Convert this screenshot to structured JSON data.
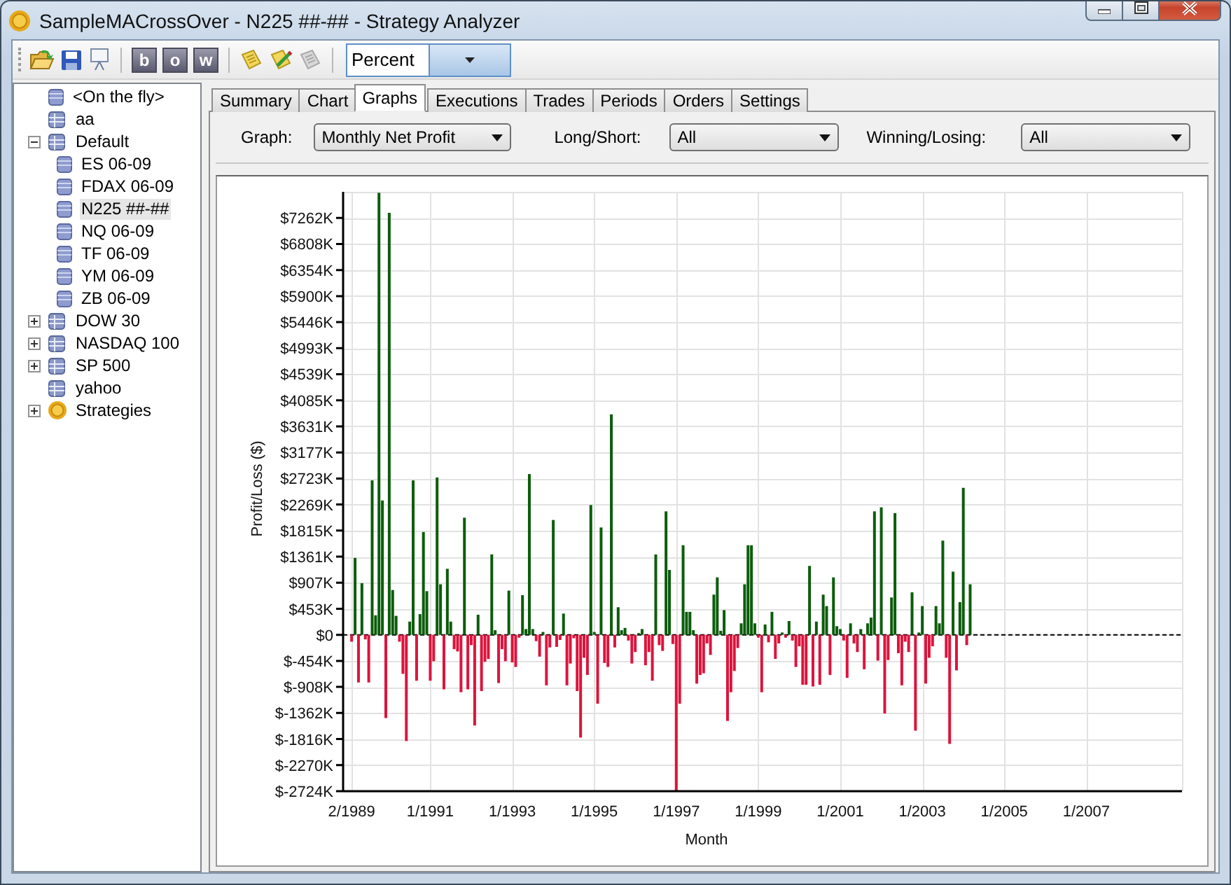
{
  "window": {
    "title": "SampleMACrossOver - N225 ##-## - Strategy Analyzer"
  },
  "toolbar": {
    "letter_buttons": [
      "b",
      "o",
      "w"
    ],
    "dropdown": {
      "value": "Percent"
    }
  },
  "tree": {
    "items": [
      {
        "label": "<On the fly>",
        "kind": "instrument",
        "selected": false
      },
      {
        "label": "aa",
        "kind": "list",
        "selected": false
      },
      {
        "label": "Default",
        "kind": "list",
        "expanded": true,
        "selected": false,
        "children": [
          {
            "label": "ES 06-09",
            "kind": "instrument",
            "selected": false
          },
          {
            "label": "FDAX 06-09",
            "kind": "instrument",
            "selected": false
          },
          {
            "label": "N225 ##-##",
            "kind": "instrument",
            "selected": true
          },
          {
            "label": "NQ 06-09",
            "kind": "instrument",
            "selected": false
          },
          {
            "label": "TF 06-09",
            "kind": "instrument",
            "selected": false
          },
          {
            "label": "YM 06-09",
            "kind": "instrument",
            "selected": false
          },
          {
            "label": "ZB 06-09",
            "kind": "instrument",
            "selected": false
          }
        ]
      },
      {
        "label": "DOW 30",
        "kind": "list",
        "expanded": false,
        "selected": false
      },
      {
        "label": "NASDAQ 100",
        "kind": "list",
        "expanded": false,
        "selected": false
      },
      {
        "label": "SP 500",
        "kind": "list",
        "expanded": false,
        "selected": false
      },
      {
        "label": "yahoo",
        "kind": "list",
        "selected": false
      },
      {
        "label": "Strategies",
        "kind": "strategy",
        "expanded": false,
        "selected": false
      }
    ]
  },
  "tabs": [
    {
      "label": "Summary",
      "selected": false
    },
    {
      "label": "Chart",
      "selected": false
    },
    {
      "label": "Graphs",
      "selected": true
    },
    {
      "label": "Executions",
      "selected": false
    },
    {
      "label": "Trades",
      "selected": false
    },
    {
      "label": "Periods",
      "selected": false
    },
    {
      "label": "Orders",
      "selected": false
    },
    {
      "label": "Settings",
      "selected": false
    }
  ],
  "filters": [
    {
      "label": "Graph:",
      "value": "Monthly Net Profit"
    },
    {
      "label": "Long/Short:",
      "value": "All"
    },
    {
      "label": "Winning/Losing:",
      "value": "All"
    }
  ],
  "graph": {
    "chart_data": {
      "type": "bar",
      "xlabel": "Month",
      "ylabel": "Profit/Loss ($)",
      "grid": true,
      "categories": [
        "2/1989",
        null,
        null,
        null,
        null,
        null,
        null,
        null,
        null,
        null,
        null,
        null,
        null,
        null,
        null,
        null,
        null,
        null,
        null,
        null,
        null,
        null,
        null,
        "1/1991",
        null,
        null,
        null,
        null,
        null,
        null,
        null,
        null,
        null,
        null,
        null,
        null,
        null,
        null,
        null,
        null,
        null,
        null,
        null,
        null,
        null,
        null,
        null,
        "1/1993",
        null,
        null,
        null,
        null,
        null,
        null,
        null,
        null,
        null,
        null,
        null,
        null,
        null,
        null,
        null,
        null,
        null,
        null,
        null,
        null,
        null,
        null,
        null,
        "1/1995",
        null,
        null,
        null,
        null,
        null,
        null,
        null,
        null,
        null,
        null,
        null,
        null,
        null,
        null,
        null,
        null,
        null,
        null,
        null,
        null,
        null,
        null,
        null,
        "1/1997",
        null,
        null,
        null,
        null,
        null,
        null,
        null,
        null,
        null,
        null,
        null,
        null,
        null,
        null,
        null,
        null,
        null,
        null,
        null,
        null,
        null,
        null,
        null,
        "1/1999",
        null,
        null,
        null,
        null,
        null,
        null,
        null,
        null,
        null,
        null,
        null,
        null,
        null,
        null,
        null,
        null,
        null,
        null,
        null,
        null,
        null,
        null,
        null,
        "1/2001",
        null,
        null,
        null,
        null,
        null,
        null,
        null,
        null,
        null,
        null,
        null,
        null,
        null,
        null,
        null,
        null,
        null,
        null,
        null,
        null,
        null,
        null,
        null,
        "1/2003",
        null,
        null,
        null,
        null,
        null,
        null,
        null,
        null,
        null,
        null,
        null,
        null,
        null,
        null,
        null,
        null,
        null,
        null,
        null,
        null,
        null,
        null,
        null,
        "1/2005",
        null,
        null,
        null,
        null,
        null,
        null,
        null,
        null,
        null,
        null,
        null,
        null,
        null,
        null,
        null,
        null,
        null,
        null,
        null,
        null,
        null,
        null,
        null,
        "1/2007",
        null,
        null,
        null,
        null,
        null,
        null,
        null,
        null,
        null,
        null,
        null,
        null,
        null,
        null,
        null,
        null,
        null,
        null,
        null,
        null,
        null,
        null,
        null,
        null,
        null,
        null,
        null,
        null
      ],
      "series": [
        {
          "color": "#0b5d0b",
          "values": [
            null,
            1340,
            null,
            900,
            null,
            null,
            2690,
            340,
            7700,
            2340,
            null,
            7350,
            780,
            330,
            null,
            null,
            null,
            230,
            2690,
            null,
            360,
            1790,
            760,
            null,
            null,
            2740,
            880,
            null,
            1150,
            230,
            null,
            null,
            null,
            2040,
            null,
            null,
            null,
            350,
            null,
            null,
            null,
            1400,
            80,
            null,
            null,
            null,
            770,
            null,
            null,
            null,
            690,
            100,
            2800,
            100,
            null,
            null,
            50,
            null,
            null,
            2000,
            null,
            null,
            370,
            null,
            null,
            null,
            null,
            null,
            null,
            null,
            2260,
            50,
            null,
            1870,
            null,
            null,
            3840,
            null,
            480,
            80,
            120,
            null,
            null,
            null,
            30,
            100,
            null,
            null,
            null,
            1400,
            null,
            null,
            2150,
            1130,
            null,
            null,
            null,
            1560,
            400,
            400,
            80,
            null,
            null,
            null,
            null,
            null,
            700,
            1000,
            70,
            430,
            null,
            null,
            null,
            null,
            200,
            880,
            1560,
            1560,
            200,
            null,
            null,
            180,
            null,
            400,
            null,
            null,
            40,
            null,
            240,
            null,
            null,
            null,
            null,
            null,
            1200,
            null,
            230,
            null,
            700,
            500,
            null,
            1000,
            150,
            100,
            null,
            null,
            200,
            null,
            null,
            100,
            null,
            200,
            300,
            2150,
            null,
            2220,
            null,
            null,
            650,
            2120,
            null,
            null,
            null,
            null,
            740,
            null,
            40,
            500,
            null,
            null,
            null,
            500,
            200,
            1640,
            null,
            null,
            1100,
            null,
            570,
            2560,
            null,
            880,
            null,
            null,
            null,
            null,
            null,
            null,
            null,
            null,
            null,
            null,
            null,
            null,
            null,
            null,
            null,
            null,
            null,
            null,
            null,
            null,
            null,
            null,
            null,
            null,
            null,
            null,
            null,
            null,
            null,
            null,
            null,
            null,
            null,
            null,
            null,
            null,
            null,
            null,
            null,
            null,
            null,
            null,
            null,
            null,
            null,
            null,
            null,
            null,
            null,
            null,
            null,
            null,
            null,
            null,
            null,
            null,
            null,
            null,
            null,
            null,
            null,
            null
          ]
        },
        {
          "color": "#dc143c",
          "values": [
            -120,
            null,
            -830,
            null,
            -80,
            -830,
            null,
            null,
            null,
            null,
            -1450,
            null,
            null,
            null,
            -120,
            -680,
            -1850,
            null,
            null,
            -800,
            null,
            null,
            null,
            -800,
            -460,
            null,
            null,
            -950,
            null,
            null,
            -250,
            -290,
            -1000,
            null,
            -950,
            -180,
            -1580,
            null,
            -980,
            -470,
            -420,
            null,
            null,
            -840,
            -250,
            -460,
            null,
            -480,
            -560,
            -50,
            null,
            null,
            null,
            null,
            -110,
            -380,
            null,
            -880,
            -220,
            null,
            -210,
            -90,
            null,
            -880,
            -500,
            -60,
            -980,
            -1790,
            -400,
            -700,
            null,
            null,
            -1200,
            null,
            -490,
            -560,
            null,
            -220,
            null,
            null,
            null,
            -100,
            -500,
            -300,
            null,
            null,
            -530,
            -300,
            -800,
            null,
            -180,
            -280,
            null,
            null,
            -160,
            -2720,
            -1200,
            null,
            null,
            null,
            null,
            -850,
            -700,
            -670,
            -150,
            -350,
            null,
            null,
            null,
            null,
            -1500,
            -1000,
            -630,
            -230,
            null,
            null,
            null,
            null,
            null,
            -50,
            -1000,
            null,
            -130,
            null,
            -420,
            -150,
            null,
            -50,
            null,
            -100,
            -560,
            -200,
            -870,
            -870,
            null,
            -900,
            null,
            -870,
            null,
            null,
            -700,
            null,
            null,
            null,
            -100,
            -750,
            null,
            -150,
            -300,
            null,
            -600,
            null,
            null,
            null,
            -450,
            null,
            -1370,
            -440,
            null,
            null,
            -320,
            -880,
            -120,
            -300,
            null,
            -1670,
            null,
            null,
            -850,
            -400,
            -200,
            null,
            null,
            null,
            -400,
            -1900,
            null,
            -620,
            null,
            null,
            -180,
            null,
            null,
            null,
            null,
            null,
            null,
            null,
            null,
            null,
            null,
            null,
            null,
            null,
            null,
            null,
            null,
            null,
            null,
            null,
            null,
            null,
            null,
            null,
            null,
            null,
            null,
            null,
            null,
            null,
            null,
            null,
            null,
            null,
            null,
            null,
            null,
            null,
            null,
            null,
            null,
            null,
            null,
            null,
            null,
            null,
            null,
            null,
            null,
            null,
            null,
            null,
            null,
            null,
            null,
            null,
            null,
            null,
            null,
            null,
            null,
            null,
            null,
            null
          ]
        }
      ],
      "ylim": [
        -2724,
        7716
      ],
      "yticks": [
        {
          "value": -2724,
          "label": "$-2724K"
        },
        {
          "value": -2270,
          "label": "$-2270K"
        },
        {
          "value": -1816,
          "label": "$-1816K"
        },
        {
          "value": -1362,
          "label": "$-1362K"
        },
        {
          "value": -908,
          "label": "$-908K"
        },
        {
          "value": -454,
          "label": "$-454K"
        },
        {
          "value": 0,
          "label": "$0"
        },
        {
          "value": 453,
          "label": "$453K"
        },
        {
          "value": 907,
          "label": "$907K"
        },
        {
          "value": 1361,
          "label": "$1361K"
        },
        {
          "value": 1815,
          "label": "$1815K"
        },
        {
          "value": 2269,
          "label": "$2269K"
        },
        {
          "value": 2723,
          "label": "$2723K"
        },
        {
          "value": 3177,
          "label": "$3177K"
        },
        {
          "value": 3631,
          "label": "$3631K"
        },
        {
          "value": 4085,
          "label": "$4085K"
        },
        {
          "value": 4539,
          "label": "$4539K"
        },
        {
          "value": 4993,
          "label": "$4993K"
        },
        {
          "value": 5446,
          "label": "$5446K"
        },
        {
          "value": 5900,
          "label": "$5900K"
        },
        {
          "value": 6354,
          "label": "$6354K"
        },
        {
          "value": 6808,
          "label": "$6808K"
        },
        {
          "value": 7262,
          "label": "$7262K"
        }
      ],
      "ref_lines": [
        {
          "axis": "y",
          "value": 0
        }
      ]
    }
  }
}
